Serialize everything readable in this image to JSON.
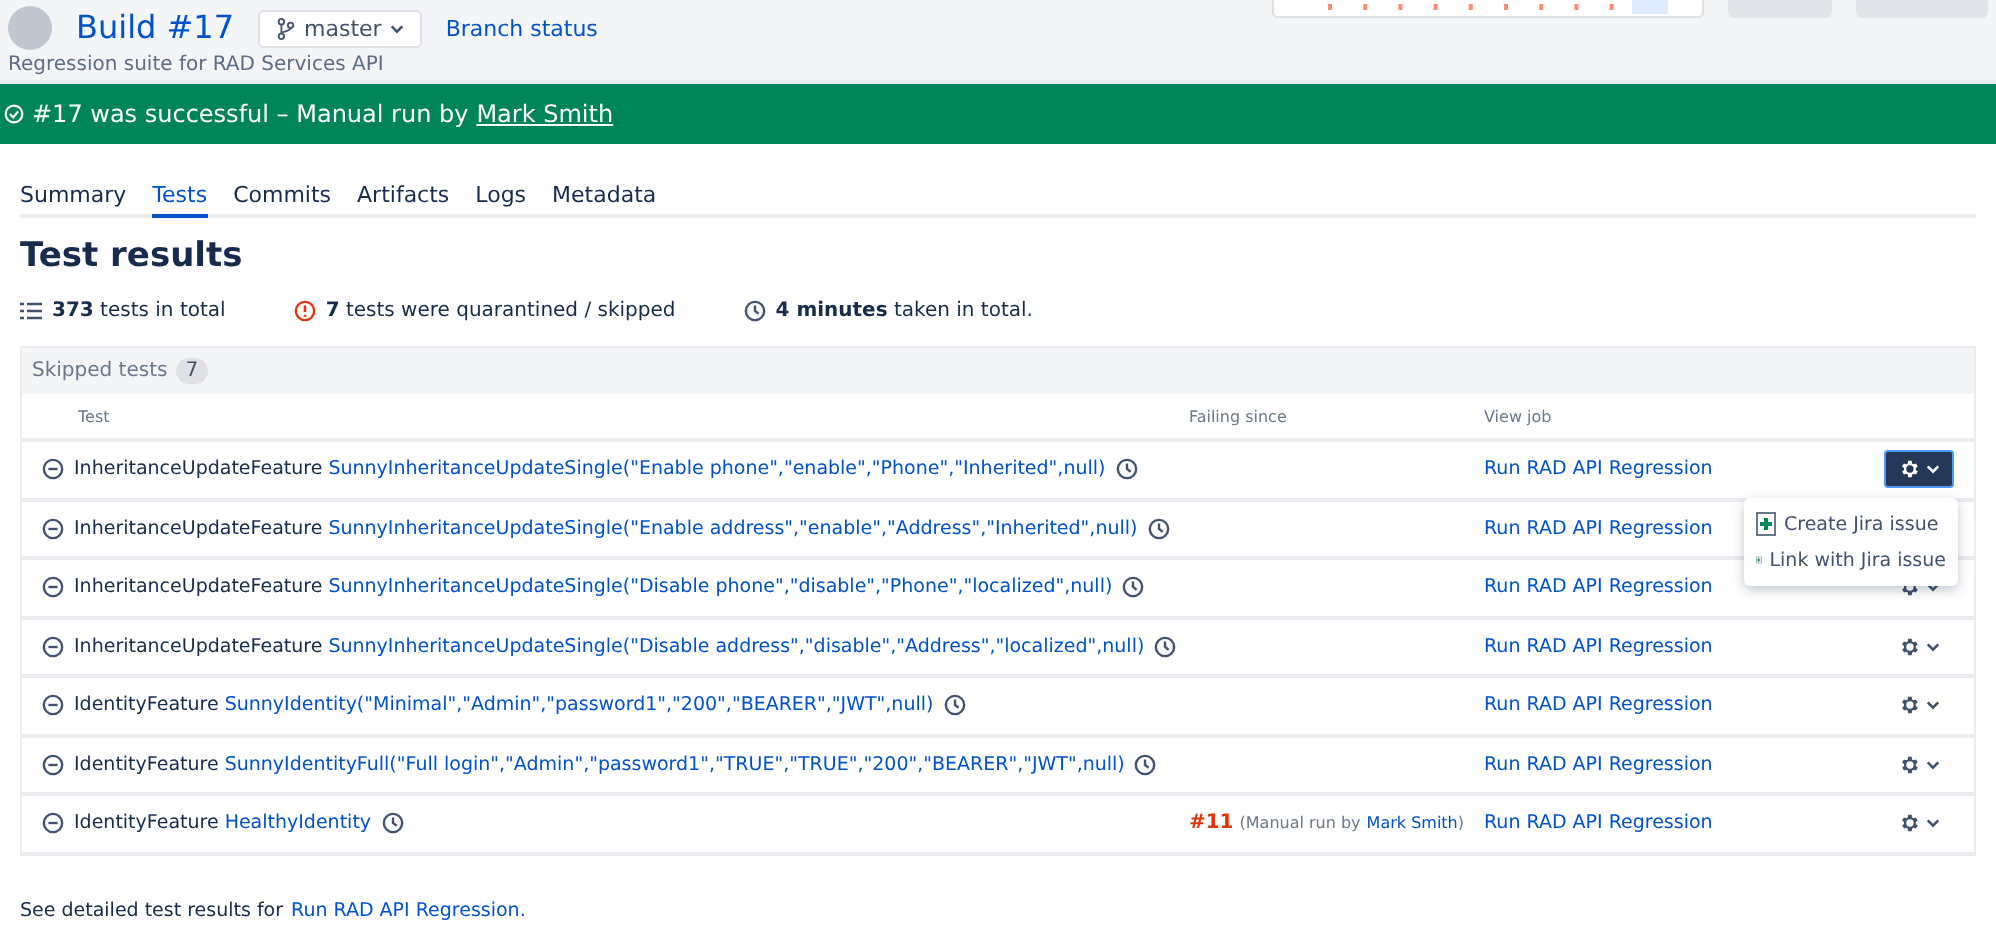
{
  "build": {
    "title": "Build #17",
    "branch": "master",
    "branch_status": "Branch status",
    "description": "Regression suite for RAD Services API"
  },
  "banner": {
    "text": "#17 was successful – Manual run by",
    "user": "Mark Smith"
  },
  "tabs": [
    {
      "label": "Summary",
      "selected": false
    },
    {
      "label": "Tests",
      "selected": true
    },
    {
      "label": "Commits",
      "selected": false
    },
    {
      "label": "Artifacts",
      "selected": false
    },
    {
      "label": "Logs",
      "selected": false
    },
    {
      "label": "Metadata",
      "selected": false
    }
  ],
  "heading": "Test results",
  "stats": [
    {
      "kind": "total",
      "text": "**373** tests in total"
    },
    {
      "kind": "skipped",
      "text": "**7** tests were quarantined / skipped"
    },
    {
      "kind": "duration",
      "text": "**4 minutes** taken in total."
    }
  ],
  "panel": {
    "title": "Skipped tests",
    "count": "7"
  },
  "table": {
    "columns": [
      "Test",
      "Failing since",
      "View job"
    ],
    "rows": [
      {
        "feature": "InheritanceUpdateFeature",
        "test": "SunnyInheritanceUpdateSingle(\"Enable phone\",\"enable\",\"Phone\",\"Inherited\",null)",
        "job": "Run RAD API Regression",
        "menu_open": true
      },
      {
        "feature": "InheritanceUpdateFeature",
        "test": "SunnyInheritanceUpdateSingle(\"Enable address\",\"enable\",\"Address\",\"Inherited\",null)",
        "job": "Run RAD API Regression",
        "menu_open": false
      },
      {
        "feature": "InheritanceUpdateFeature",
        "test": "SunnyInheritanceUpdateSingle(\"Disable phone\",\"disable\",\"Phone\",\"localized\",null)",
        "job": "Run RAD API Regression",
        "menu_open": false
      },
      {
        "feature": "InheritanceUpdateFeature",
        "test": "SunnyInheritanceUpdateSingle(\"Disable address\",\"disable\",\"Address\",\"localized\",null)",
        "job": "Run RAD API Regression",
        "menu_open": false
      },
      {
        "feature": "IdentityFeature",
        "test": "SunnyIdentity(\"Minimal\",\"Admin\",\"password1\",\"200\",\"BEARER\",\"JWT\",null)",
        "job": "Run RAD API Regression",
        "menu_open": false
      },
      {
        "feature": "IdentityFeature",
        "test": "SunnyIdentityFull(\"Full login\",\"Admin\",\"password1\",\"TRUE\",\"TRUE\",\"200\",\"BEARER\",\"JWT\",null)",
        "job": "Run RAD API Regression",
        "menu_open": false
      },
      {
        "feature": "IdentityFeature",
        "test": "HealthyIdentity",
        "job": "Run RAD API Regression",
        "menu_open": false,
        "failing_since": {
          "build": "#11",
          "before": "(Manual run by",
          "user": "Mark Smith",
          "after": ")"
        }
      }
    ]
  },
  "menu": [
    "Create Jira issue",
    "Link with Jira issue"
  ],
  "footer": {
    "text": "See detailed test results for",
    "link": "Run RAD API Regression."
  }
}
